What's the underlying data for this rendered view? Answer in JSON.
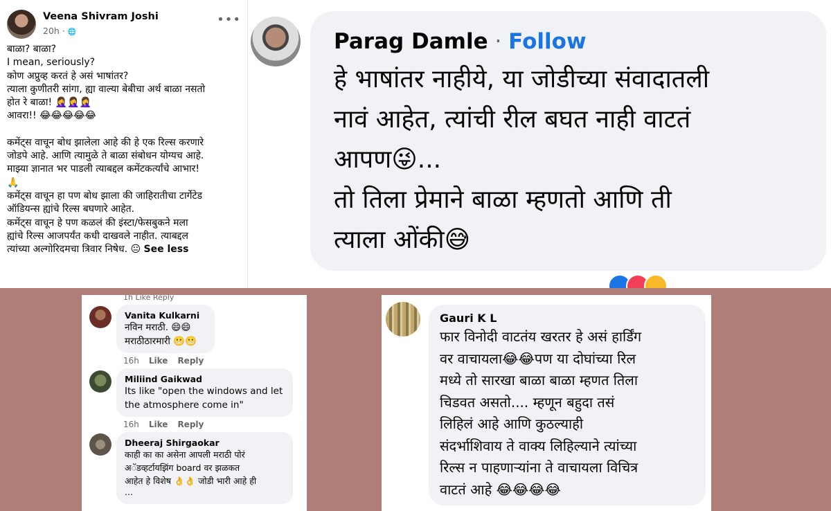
{
  "post": {
    "author": "Veena Shivram Joshi",
    "time": "20h · ",
    "globe": "🌐",
    "more": "•••",
    "lines": [
      "बाळा? बाळा?",
      "I mean, seriously?",
      "कोण अप्रुव्ह करतं हे असं भाषांतर?",
      "त्याला कुणीतरी सांगा, ह्या वाल्या बेबीचा अर्थ बाळा नसतो",
      "होत रे बाळा! 🤦‍♀️🤦‍♀️🤦‍♀️",
      "आवरा!! 😂😂😂😂😂",
      "",
      "कमेंट्स वाचून बोध झालेला आहे की हे एक रिल्स करणारे",
      "जोडपे आहे. आणि त्यामुळे ते बाळा संबोधन योग्यच आहे.",
      "माझ्या ज्ञानात भर पाडली त्याबद्दल कमेंटकर्त्यांचे आभार!",
      "🙏",
      "कमेंट्स वाचून हा पण बोध झाला की जाहिरातीचा टार्गेटेड",
      "ऑडियन्स ह्यांचे रिल्स बघणारे आहेत.",
      "कमेंट्स वाचून हे पण कळलं की इंस्टा/फेसबुकने मला",
      "ह्यांचे रिल्स आजपर्यंत कधी दाखवले नाहीत. त्याबद्दल",
      "त्यांच्या अल्गोरिदमचा त्रिवार निषेध. 😐 "
    ],
    "see_less": "See less"
  },
  "big_comment": {
    "name": "Parag Damle",
    "dot": " · ",
    "follow": "Follow",
    "lines": [
      "हे भाषांतर नाहीये, या जोडीच्या संवादातली",
      "नावं आहेत, त्यांची रील बघत नाही वाटतं",
      "आपण😜...",
      "तो तिला प्रेमाने बाळा म्हणतो आणि ती",
      "त्याला ओंकी😅"
    ]
  },
  "small_comments": {
    "top_ghost": "1h    Like    Reply",
    "items": [
      {
        "name": "Vanita Kulkarni",
        "lines": [
          "नविन मराठी. 😄😄",
          "मराठीठारमारी 😬😬"
        ],
        "time": "16h",
        "like": "Like",
        "reply": "Reply"
      },
      {
        "name": "Miliind Gaikwad",
        "lines": [
          "Its like \"open the windows and let",
          "the atmosphere come in\""
        ],
        "time": "16h",
        "like": "Like",
        "reply": "Reply"
      },
      {
        "name": "Dheeraj Shirgaokar",
        "lines": [
          "काही का का असेना आपली मराठी पोरं",
          "अॅडव्हर्टायझिंग board वर झळकत",
          "आहेत हे विशेष 👌👌 जोडी भारी आहे ही",
          "..."
        ]
      }
    ]
  },
  "gauri_comment": {
    "name": "Gauri K L",
    "lines": [
      "फार विनोदी वाटतंय खरतर हे असं हार्डिंग",
      "वर वाचायला😂😂पण या दोघांच्या रिल",
      "मध्ये तो सारखा बाळा बाळा म्हणत तिला",
      "चिडवत असतो.... म्हणून बहुदा तसं",
      "लिहिलं आहे आणि कुठल्याही",
      "संदर्भाशिवाय ते वाक्य लिहिल्याने त्यांच्या",
      "रिल्स न पाहणाऱ्यांना ते वाचायला विचित्र",
      "वाटतं आहे 😂😂😂😂"
    ]
  },
  "colors": {
    "background": "#b07e78",
    "link": "#1b74e4",
    "bubble": "#f0f2f5",
    "meta": "#65676b"
  }
}
